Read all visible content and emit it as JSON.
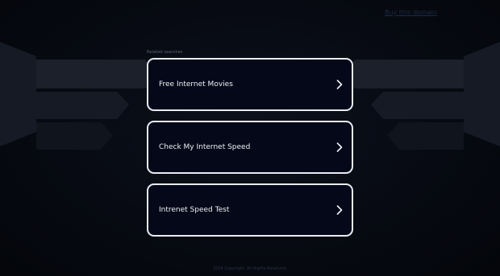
{
  "header": {
    "buy_domain_link": "Buy this domain"
  },
  "related": {
    "label": "Related searches",
    "items": [
      {
        "label": "Free Internet Movies"
      },
      {
        "label": "Check My Internet Speed"
      },
      {
        "label": "Intrenet Speed Test"
      }
    ]
  },
  "footer": {
    "text": "2024 Copyright. All Rights Reserved."
  },
  "colors": {
    "background": "#05070d",
    "card_background": "#040818",
    "card_border": "#e8ecf2",
    "card_text": "#eef1f6"
  },
  "icons": {
    "card_arrow": "chevron-right-icon"
  }
}
